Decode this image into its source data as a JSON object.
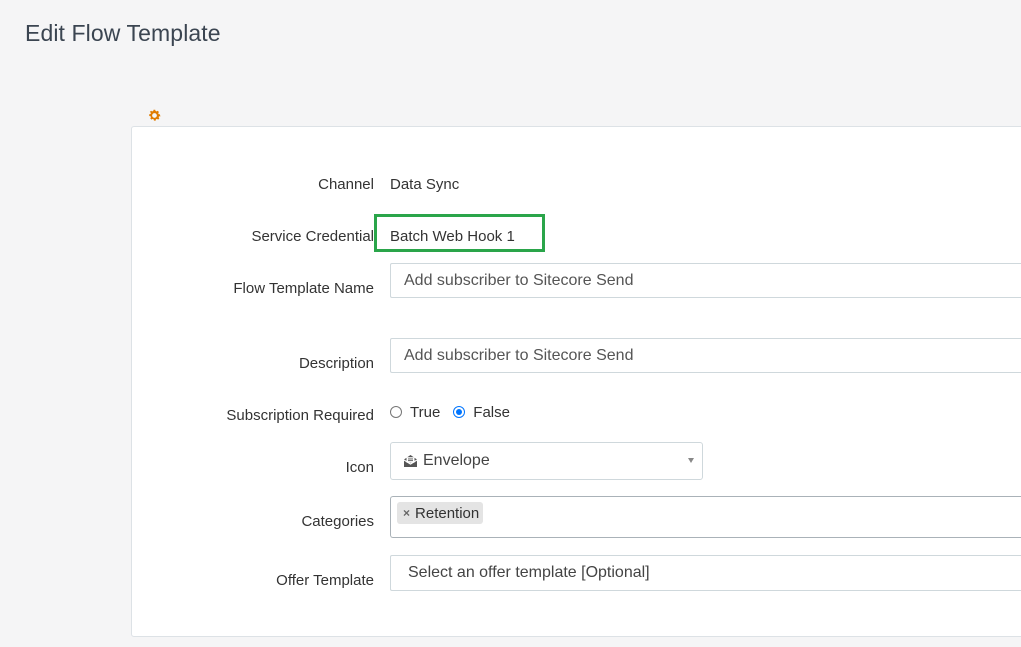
{
  "page": {
    "title": "Edit Flow Template"
  },
  "settings_icon": "gear-icon",
  "form": {
    "channel": {
      "label": "Channel",
      "value": "Data Sync"
    },
    "service_credential": {
      "label": "Service Credential",
      "value": "Batch Web Hook 1",
      "highlight_color": "#2aa54a"
    },
    "flow_template_name": {
      "label": "Flow Template Name",
      "value": "Add subscriber to Sitecore Send"
    },
    "description": {
      "label": "Description",
      "value": "Add subscriber to Sitecore Send"
    },
    "subscription_required": {
      "label": "Subscription Required",
      "options": [
        "True",
        "False"
      ],
      "selected": "False"
    },
    "icon": {
      "label": "Icon",
      "selected": "Envelope",
      "icon_name": "envelope-open-icon"
    },
    "categories": {
      "label": "Categories",
      "tags": [
        "Retention"
      ],
      "remove_glyph": "×"
    },
    "offer_template": {
      "label": "Offer Template",
      "placeholder": "Select an offer template [Optional]"
    }
  },
  "colors": {
    "accent_gear": "#e07b00",
    "radio_checked": "#0075ff"
  }
}
